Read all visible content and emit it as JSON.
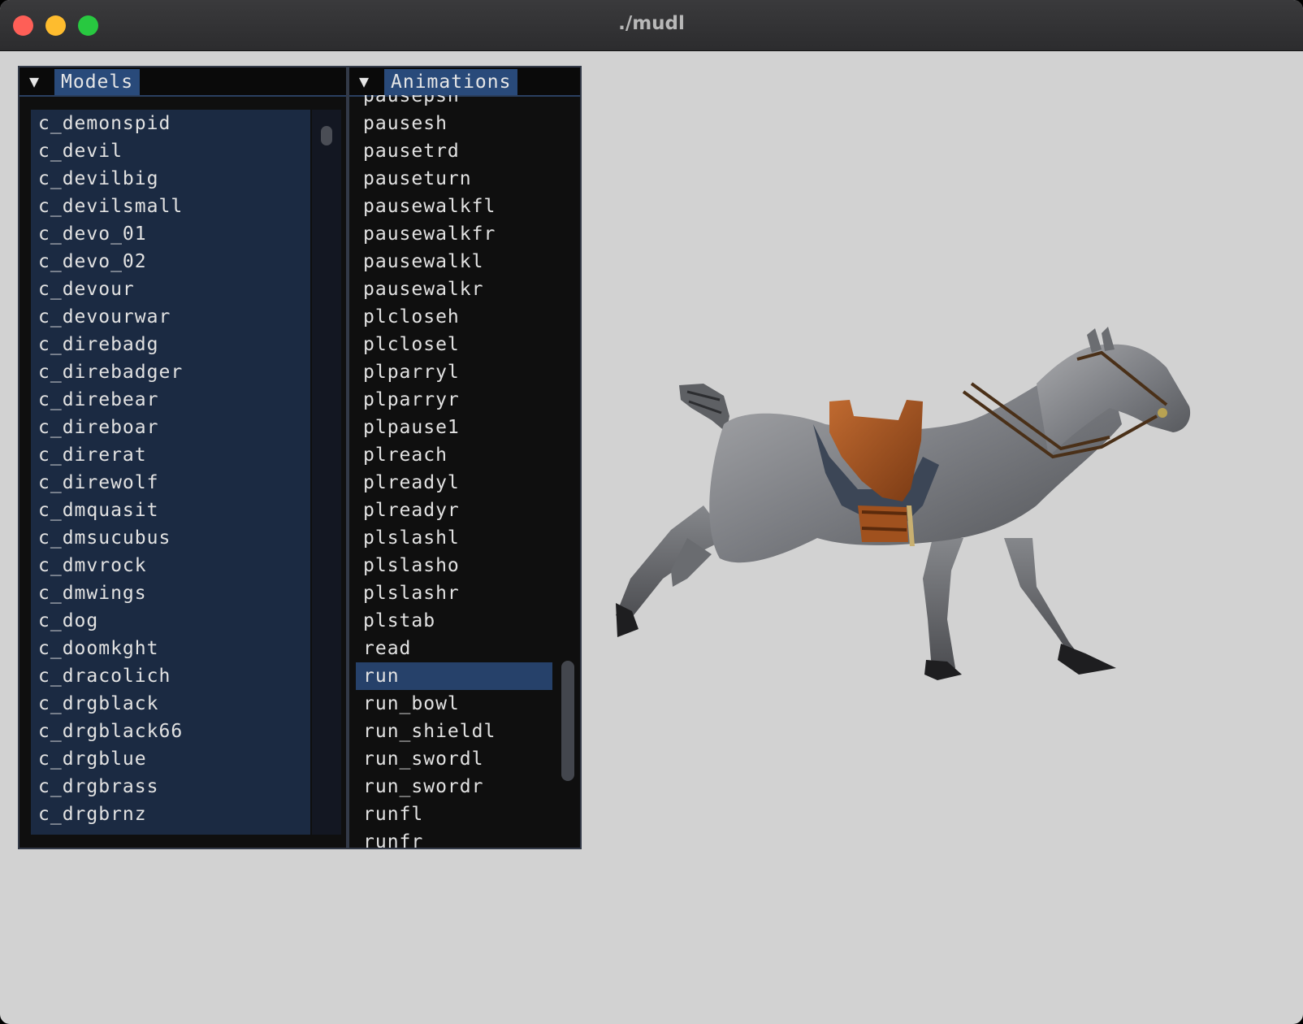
{
  "window": {
    "title": "./mudl"
  },
  "models_panel": {
    "tab_label": "Models",
    "items": [
      "c_demonspid",
      "c_devil",
      "c_devilbig",
      "c_devilsmall",
      "c_devo_01",
      "c_devo_02",
      "c_devour",
      "c_devourwar",
      "c_direbadg",
      "c_direbadger",
      "c_direbear",
      "c_direboar",
      "c_direrat",
      "c_direwolf",
      "c_dmquasit",
      "c_dmsucubus",
      "c_dmvrock",
      "c_dmwings",
      "c_dog",
      "c_doomkght",
      "c_dracolich",
      "c_drgblack",
      "c_drgblack66",
      "c_drgblue",
      "c_drgbrass",
      "c_drgbrnz"
    ]
  },
  "animations_panel": {
    "tab_label": "Animations",
    "items": [
      "pausepsn",
      "pausesh",
      "pausetrd",
      "pauseturn",
      "pausewalkfl",
      "pausewalkfr",
      "pausewalkl",
      "pausewalkr",
      "plcloseh",
      "plclosel",
      "plparryl",
      "plparryr",
      "plpause1",
      "plreach",
      "plreadyl",
      "plreadyr",
      "plslashl",
      "plslasho",
      "plslashr",
      "plstab",
      "read",
      "run",
      "run_bowl",
      "run_shieldl",
      "run_swordl",
      "run_swordr",
      "runfl",
      "runfr"
    ],
    "selected": "run"
  },
  "viewport": {
    "subject": "horse-model",
    "background_color": "#d2d2d2"
  }
}
